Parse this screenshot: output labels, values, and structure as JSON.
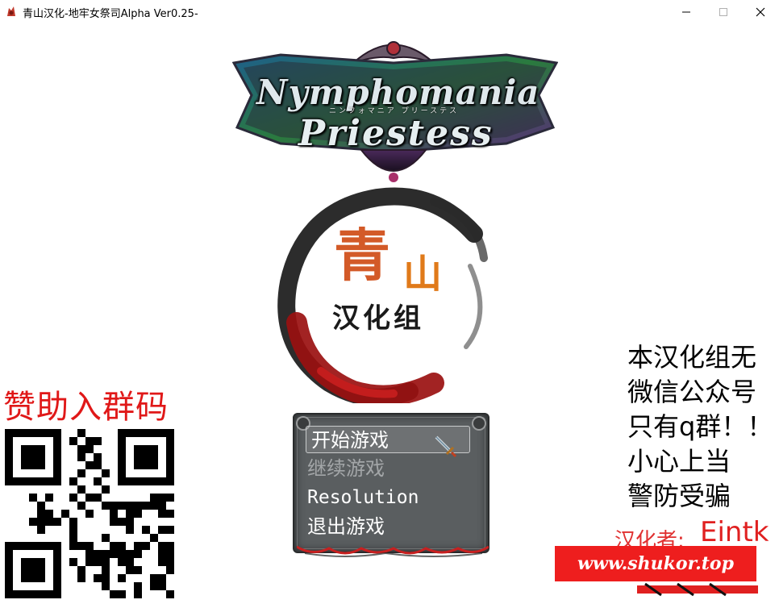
{
  "window": {
    "title": "青山汉化-地牢女祭司Alpha Ver0.25-",
    "controls": [
      "minimize",
      "maximize",
      "close"
    ]
  },
  "logo": {
    "line1": "Nymphomania",
    "subtitle": "ニンフォマニア プリーステス",
    "line2": "Priestess"
  },
  "emblem": {
    "char1": "青",
    "char2": "山",
    "group": "汉化组"
  },
  "menu": {
    "items": [
      {
        "label": "开始游戏",
        "state": "selected"
      },
      {
        "label": "继续游戏",
        "state": "disabled"
      },
      {
        "label": "Resolution",
        "state": "normal"
      },
      {
        "label": "退出游戏",
        "state": "normal"
      }
    ]
  },
  "sponsor": {
    "title": "赞助入群码"
  },
  "notice": {
    "lines": [
      "本汉化组无",
      "微信公众号",
      "只有q群！！",
      "小心上当",
      "警防受骗"
    ]
  },
  "credit": {
    "label": "汉化者:",
    "name": "Eintk"
  },
  "watermark": {
    "text": "www.shukor.top"
  },
  "colors": {
    "sponsor_red": "#e01818",
    "credit_red": "#e02020",
    "menu_bg": "#5a5e60",
    "watermark_bg": "#ee1e1e"
  }
}
